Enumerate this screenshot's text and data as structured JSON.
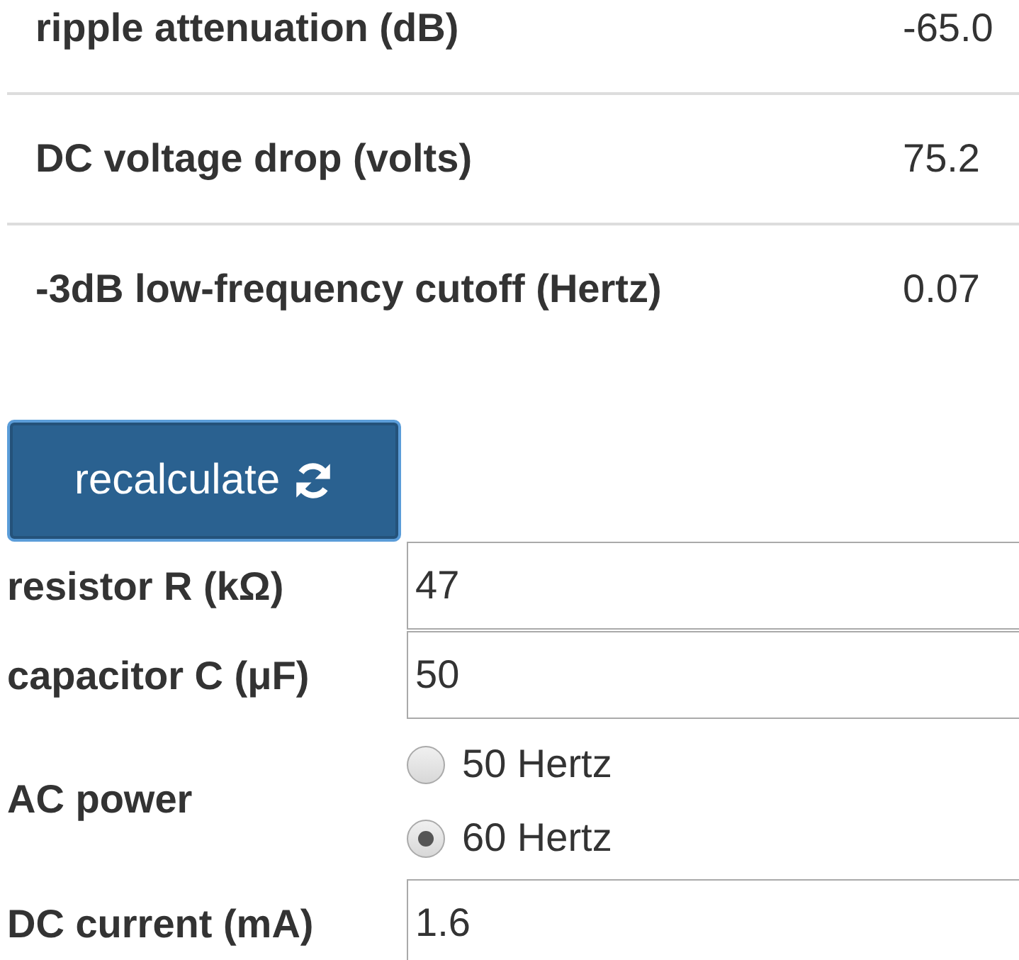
{
  "results": [
    {
      "label": "ripple attenuation (dB)",
      "value": "-65.0"
    },
    {
      "label": "DC voltage drop (volts)",
      "value": "75.2"
    },
    {
      "label": "-3dB low-frequency cutoff (Hertz)",
      "value": "0.07"
    }
  ],
  "button": {
    "label": "recalculate"
  },
  "form": [
    {
      "kind": "input",
      "label": "resistor R (kΩ)",
      "value": "47"
    },
    {
      "kind": "input",
      "label": "capacitor C (μF)",
      "value": "50"
    },
    {
      "kind": "radio",
      "label": "AC power",
      "options": [
        {
          "label": "50 Hertz",
          "selected": false
        },
        {
          "label": "60 Hertz",
          "selected": true
        }
      ]
    },
    {
      "kind": "input",
      "label": "DC current (mA)",
      "value": "1.6"
    }
  ]
}
